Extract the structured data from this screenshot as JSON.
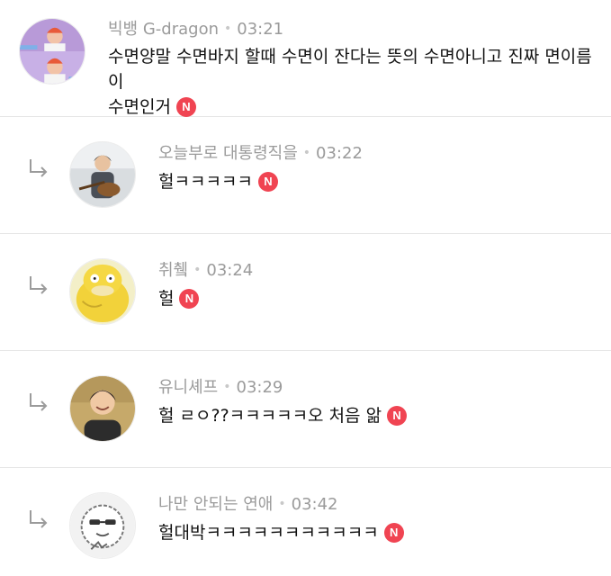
{
  "badge": {
    "new_label": "N",
    "color": "#f04452"
  },
  "comments": [
    {
      "author": "빅뱅 G-dragon",
      "time": "03:21",
      "text_line1": "수면양말 수면바지 할때 수면이 잔다는 뜻의 수면아니고 진짜 면이름이",
      "text_line2": "수면인거",
      "is_reply": false
    },
    {
      "author": "오늘부로 대통령직을",
      "time": "03:22",
      "text": "헐ㅋㅋㅋㅋㅋ",
      "is_reply": true
    },
    {
      "author": "취췤",
      "time": "03:24",
      "text": "헐",
      "is_reply": true
    },
    {
      "author": "유니셰프",
      "time": "03:29",
      "text": "헐 ㄹㅇ??ㅋㅋㅋㅋㅋ오 처음 앎",
      "is_reply": true
    },
    {
      "author": "나만 안되는 연애",
      "time": "03:42",
      "text": "헐대박ㅋㅋㅋㅋㅋㅋㅋㅋㅋㅋㅋ",
      "is_reply": true
    }
  ]
}
